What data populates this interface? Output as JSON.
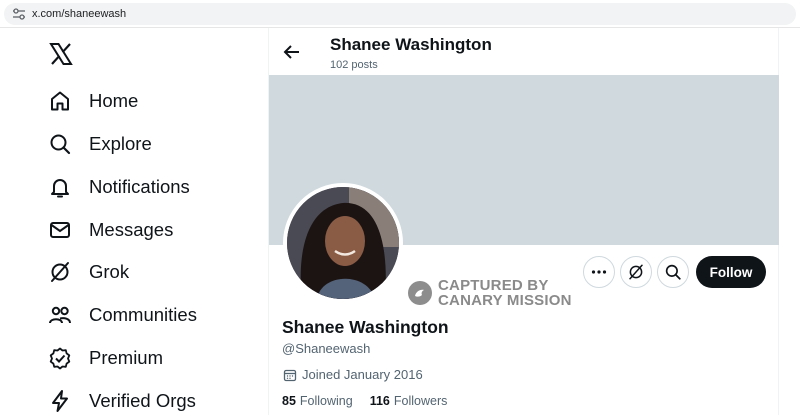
{
  "browser": {
    "url": "x.com/shaneewash"
  },
  "nav": {
    "items": [
      {
        "label": "Home",
        "icon": "home-icon"
      },
      {
        "label": "Explore",
        "icon": "search-icon"
      },
      {
        "label": "Notifications",
        "icon": "bell-icon"
      },
      {
        "label": "Messages",
        "icon": "envelope-icon"
      },
      {
        "label": "Grok",
        "icon": "grok-icon"
      },
      {
        "label": "Communities",
        "icon": "people-icon"
      },
      {
        "label": "Premium",
        "icon": "verified-badge-icon"
      },
      {
        "label": "Verified Orgs",
        "icon": "lightning-icon"
      }
    ]
  },
  "header": {
    "name": "Shanee Washington",
    "posts": "102 posts"
  },
  "actions": {
    "follow_label": "Follow"
  },
  "watermark": {
    "line1": "CAPTURED BY",
    "line2": "CANARY MISSION"
  },
  "profile": {
    "name": "Shanee Washington",
    "handle": "@Shaneewash",
    "joined": "Joined January 2016",
    "following_count": "85",
    "following_label": "Following",
    "followers_count": "116",
    "followers_label": "Followers"
  },
  "colors": {
    "banner": "#cfd9de",
    "text_primary": "#0f1419",
    "text_secondary": "#536471",
    "button_dark": "#0f1419"
  }
}
